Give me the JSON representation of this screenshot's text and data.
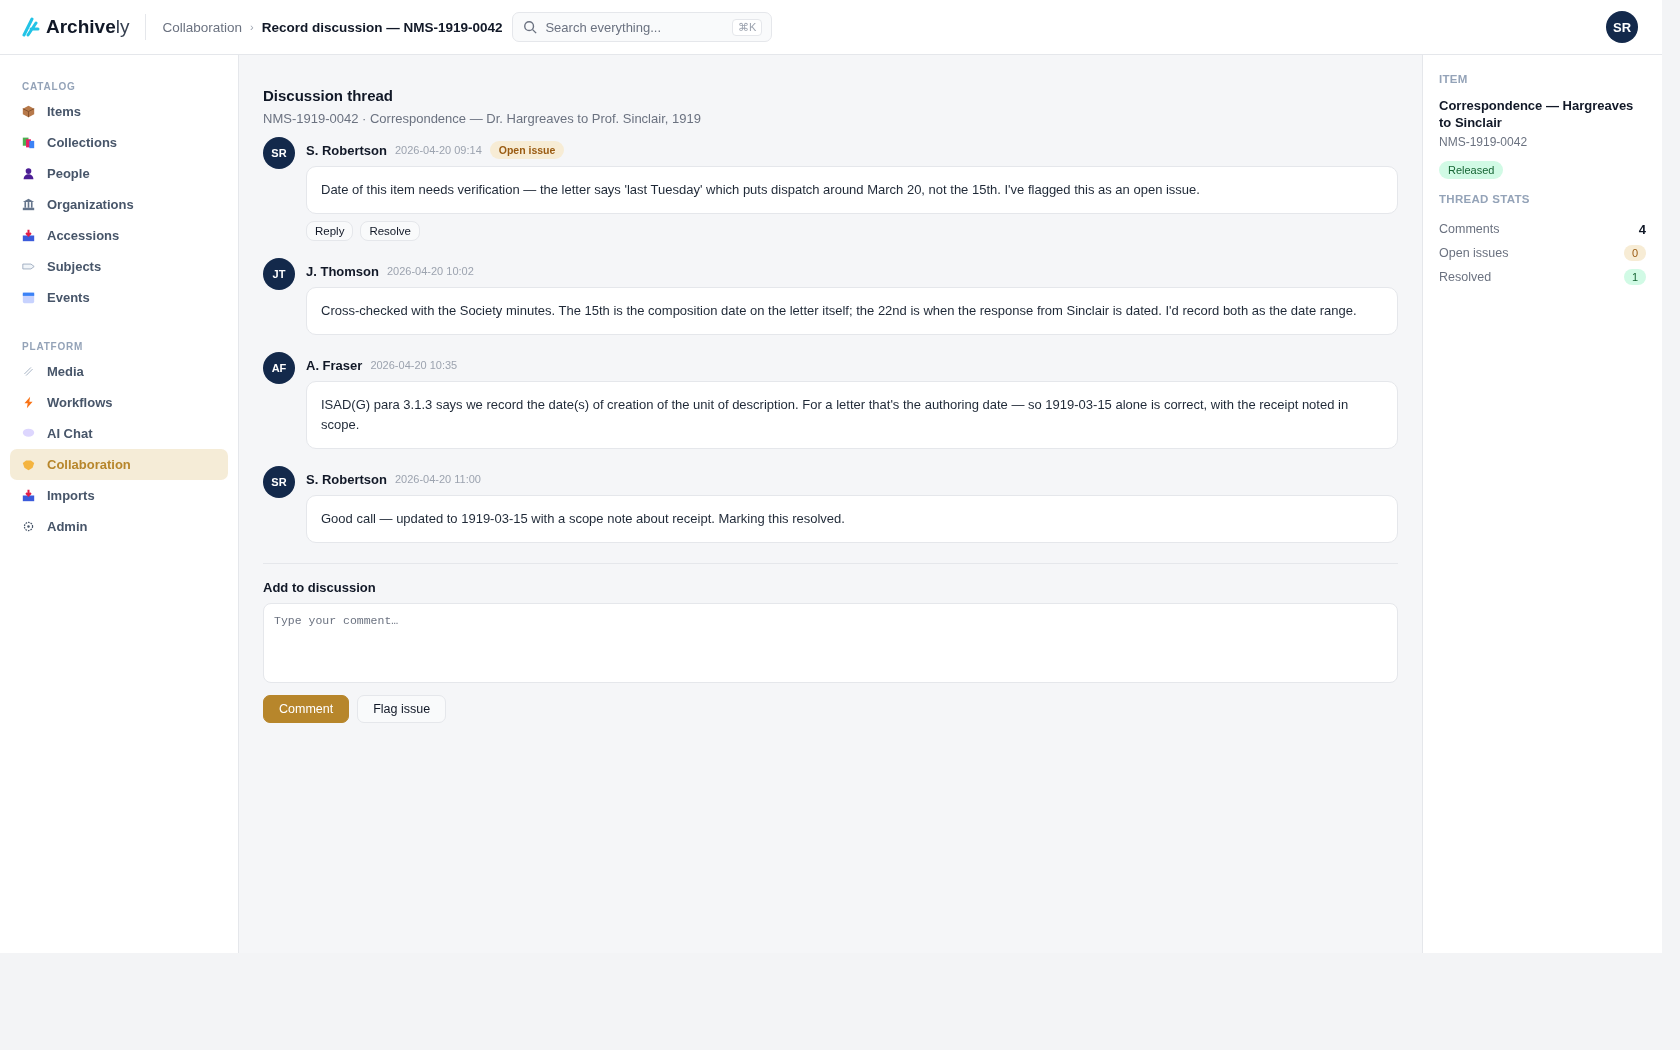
{
  "header": {
    "logo": "**Archive**ly",
    "breadcrumb_separator": "›",
    "breadcrumb": [
      {
        "label": "Collaboration",
        "current": false
      },
      {
        "label": "Record discussion — NMS-1919-0042",
        "current": true
      }
    ],
    "search": {
      "placeholder": "Search everything...",
      "shortcut": "⌘K"
    },
    "user": {
      "initials": "SR"
    }
  },
  "sidebar": {
    "sections": [
      {
        "title": "CATALOG",
        "items": [
          {
            "label": "Items",
            "selected": false
          },
          {
            "label": "Collections",
            "selected": false
          },
          {
            "label": "People",
            "selected": false
          },
          {
            "label": "Organizations",
            "selected": false
          },
          {
            "label": "Accessions",
            "selected": false
          },
          {
            "label": "Subjects",
            "selected": false
          },
          {
            "label": "Events",
            "selected": false
          }
        ]
      },
      {
        "title": "PLATFORM",
        "items": [
          {
            "label": "Media",
            "selected": false
          },
          {
            "label": "Workflows",
            "selected": false
          },
          {
            "label": "AI Chat",
            "selected": false
          },
          {
            "label": "Collaboration",
            "selected": true
          },
          {
            "label": "Imports",
            "selected": false
          },
          {
            "label": "Admin",
            "selected": false
          }
        ]
      }
    ]
  },
  "thread": {
    "title": "Discussion thread",
    "subtitle": "NMS-1919-0042 · Correspondence — Dr. Hargreaves to Prof. Sinclair, 1919",
    "comments": [
      {
        "initials": "SR",
        "author": "S. Robertson",
        "time": "2026-04-20 09:14",
        "badge": "Open issue",
        "body": "Date of this item needs verification — the letter says 'last Tuesday' which puts dispatch around March 20, not the 15th. I've flagged this as an open issue.",
        "actions": [
          "Reply",
          "Resolve"
        ]
      },
      {
        "initials": "JT",
        "author": "J. Thomson",
        "time": "2026-04-20 10:02",
        "body": "Cross-checked with the Society minutes. The 15th is the composition date on the letter itself; the 22nd is when the response from Sinclair is dated. I'd record both as the date range."
      },
      {
        "initials": "AF",
        "author": "A. Fraser",
        "time": "2026-04-20 10:35",
        "body": "ISAD(G) para 3.1.3 says we record the date(s) of creation of the unit of description. For a letter that's the authoring date — so 1919-03-15 alone is correct, with the receipt noted in scope."
      },
      {
        "initials": "SR",
        "author": "S. Robertson",
        "time": "2026-04-20 11:00",
        "body": "Good call — updated to 1919-03-15 with a scope note about receipt. Marking this resolved."
      }
    ],
    "compose": {
      "label": "Add to discussion",
      "placeholder": "Type your comment…",
      "buttons": [
        {
          "label": "Comment",
          "kind": "primary"
        },
        {
          "label": "Flag issue",
          "kind": "secondary"
        }
      ]
    }
  },
  "details": {
    "item_heading": "ITEM",
    "item_title": "Correspondence — Hargreaves to Sinclair",
    "item_id": "NMS-1919-0042",
    "status": "Released",
    "stats_heading": "THREAD STATS",
    "stats": [
      {
        "label": "Comments",
        "value": "4",
        "kind": "plain"
      },
      {
        "label": "Open issues",
        "value": "0",
        "kind": "warning"
      },
      {
        "label": "Resolved",
        "value": "1",
        "kind": "success"
      }
    ]
  }
}
